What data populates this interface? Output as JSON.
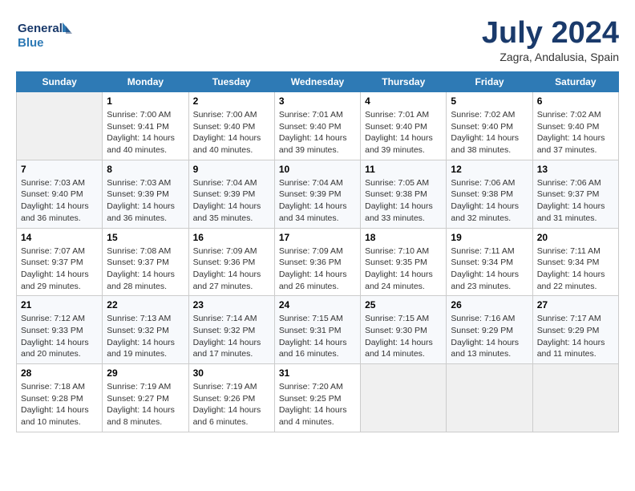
{
  "header": {
    "logo_general": "General",
    "logo_blue": "Blue",
    "month_title": "July 2024",
    "location": "Zagra, Andalusia, Spain"
  },
  "days_of_week": [
    "Sunday",
    "Monday",
    "Tuesday",
    "Wednesday",
    "Thursday",
    "Friday",
    "Saturday"
  ],
  "weeks": [
    [
      {
        "day": "",
        "empty": true
      },
      {
        "day": "1",
        "sunrise": "7:00 AM",
        "sunset": "9:41 PM",
        "daylight": "14 hours and 40 minutes."
      },
      {
        "day": "2",
        "sunrise": "7:00 AM",
        "sunset": "9:40 PM",
        "daylight": "14 hours and 40 minutes."
      },
      {
        "day": "3",
        "sunrise": "7:01 AM",
        "sunset": "9:40 PM",
        "daylight": "14 hours and 39 minutes."
      },
      {
        "day": "4",
        "sunrise": "7:01 AM",
        "sunset": "9:40 PM",
        "daylight": "14 hours and 39 minutes."
      },
      {
        "day": "5",
        "sunrise": "7:02 AM",
        "sunset": "9:40 PM",
        "daylight": "14 hours and 38 minutes."
      },
      {
        "day": "6",
        "sunrise": "7:02 AM",
        "sunset": "9:40 PM",
        "daylight": "14 hours and 37 minutes."
      }
    ],
    [
      {
        "day": "7",
        "sunrise": "7:03 AM",
        "sunset": "9:40 PM",
        "daylight": "14 hours and 36 minutes."
      },
      {
        "day": "8",
        "sunrise": "7:03 AM",
        "sunset": "9:39 PM",
        "daylight": "14 hours and 36 minutes."
      },
      {
        "day": "9",
        "sunrise": "7:04 AM",
        "sunset": "9:39 PM",
        "daylight": "14 hours and 35 minutes."
      },
      {
        "day": "10",
        "sunrise": "7:04 AM",
        "sunset": "9:39 PM",
        "daylight": "14 hours and 34 minutes."
      },
      {
        "day": "11",
        "sunrise": "7:05 AM",
        "sunset": "9:38 PM",
        "daylight": "14 hours and 33 minutes."
      },
      {
        "day": "12",
        "sunrise": "7:06 AM",
        "sunset": "9:38 PM",
        "daylight": "14 hours and 32 minutes."
      },
      {
        "day": "13",
        "sunrise": "7:06 AM",
        "sunset": "9:37 PM",
        "daylight": "14 hours and 31 minutes."
      }
    ],
    [
      {
        "day": "14",
        "sunrise": "7:07 AM",
        "sunset": "9:37 PM",
        "daylight": "14 hours and 29 minutes."
      },
      {
        "day": "15",
        "sunrise": "7:08 AM",
        "sunset": "9:37 PM",
        "daylight": "14 hours and 28 minutes."
      },
      {
        "day": "16",
        "sunrise": "7:09 AM",
        "sunset": "9:36 PM",
        "daylight": "14 hours and 27 minutes."
      },
      {
        "day": "17",
        "sunrise": "7:09 AM",
        "sunset": "9:36 PM",
        "daylight": "14 hours and 26 minutes."
      },
      {
        "day": "18",
        "sunrise": "7:10 AM",
        "sunset": "9:35 PM",
        "daylight": "14 hours and 24 minutes."
      },
      {
        "day": "19",
        "sunrise": "7:11 AM",
        "sunset": "9:34 PM",
        "daylight": "14 hours and 23 minutes."
      },
      {
        "day": "20",
        "sunrise": "7:11 AM",
        "sunset": "9:34 PM",
        "daylight": "14 hours and 22 minutes."
      }
    ],
    [
      {
        "day": "21",
        "sunrise": "7:12 AM",
        "sunset": "9:33 PM",
        "daylight": "14 hours and 20 minutes."
      },
      {
        "day": "22",
        "sunrise": "7:13 AM",
        "sunset": "9:32 PM",
        "daylight": "14 hours and 19 minutes."
      },
      {
        "day": "23",
        "sunrise": "7:14 AM",
        "sunset": "9:32 PM",
        "daylight": "14 hours and 17 minutes."
      },
      {
        "day": "24",
        "sunrise": "7:15 AM",
        "sunset": "9:31 PM",
        "daylight": "14 hours and 16 minutes."
      },
      {
        "day": "25",
        "sunrise": "7:15 AM",
        "sunset": "9:30 PM",
        "daylight": "14 hours and 14 minutes."
      },
      {
        "day": "26",
        "sunrise": "7:16 AM",
        "sunset": "9:29 PM",
        "daylight": "14 hours and 13 minutes."
      },
      {
        "day": "27",
        "sunrise": "7:17 AM",
        "sunset": "9:29 PM",
        "daylight": "14 hours and 11 minutes."
      }
    ],
    [
      {
        "day": "28",
        "sunrise": "7:18 AM",
        "sunset": "9:28 PM",
        "daylight": "14 hours and 10 minutes."
      },
      {
        "day": "29",
        "sunrise": "7:19 AM",
        "sunset": "9:27 PM",
        "daylight": "14 hours and 8 minutes."
      },
      {
        "day": "30",
        "sunrise": "7:19 AM",
        "sunset": "9:26 PM",
        "daylight": "14 hours and 6 minutes."
      },
      {
        "day": "31",
        "sunrise": "7:20 AM",
        "sunset": "9:25 PM",
        "daylight": "14 hours and 4 minutes."
      },
      {
        "day": "",
        "empty": true
      },
      {
        "day": "",
        "empty": true
      },
      {
        "day": "",
        "empty": true
      }
    ]
  ]
}
